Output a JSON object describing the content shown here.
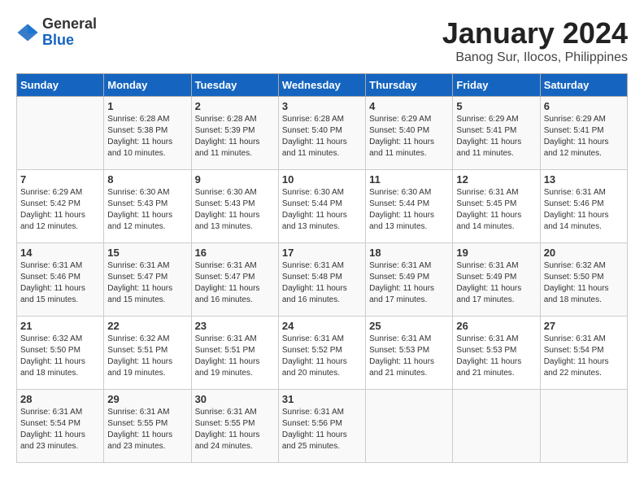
{
  "header": {
    "logo_general": "General",
    "logo_blue": "Blue",
    "month_title": "January 2024",
    "location": "Banog Sur, Ilocos, Philippines"
  },
  "days_of_week": [
    "Sunday",
    "Monday",
    "Tuesday",
    "Wednesday",
    "Thursday",
    "Friday",
    "Saturday"
  ],
  "weeks": [
    [
      {
        "day": "",
        "sunrise": "",
        "sunset": "",
        "daylight": ""
      },
      {
        "day": "1",
        "sunrise": "Sunrise: 6:28 AM",
        "sunset": "Sunset: 5:38 PM",
        "daylight": "Daylight: 11 hours and 10 minutes."
      },
      {
        "day": "2",
        "sunrise": "Sunrise: 6:28 AM",
        "sunset": "Sunset: 5:39 PM",
        "daylight": "Daylight: 11 hours and 11 minutes."
      },
      {
        "day": "3",
        "sunrise": "Sunrise: 6:28 AM",
        "sunset": "Sunset: 5:40 PM",
        "daylight": "Daylight: 11 hours and 11 minutes."
      },
      {
        "day": "4",
        "sunrise": "Sunrise: 6:29 AM",
        "sunset": "Sunset: 5:40 PM",
        "daylight": "Daylight: 11 hours and 11 minutes."
      },
      {
        "day": "5",
        "sunrise": "Sunrise: 6:29 AM",
        "sunset": "Sunset: 5:41 PM",
        "daylight": "Daylight: 11 hours and 11 minutes."
      },
      {
        "day": "6",
        "sunrise": "Sunrise: 6:29 AM",
        "sunset": "Sunset: 5:41 PM",
        "daylight": "Daylight: 11 hours and 12 minutes."
      }
    ],
    [
      {
        "day": "7",
        "sunrise": "Sunrise: 6:29 AM",
        "sunset": "Sunset: 5:42 PM",
        "daylight": "Daylight: 11 hours and 12 minutes."
      },
      {
        "day": "8",
        "sunrise": "Sunrise: 6:30 AM",
        "sunset": "Sunset: 5:43 PM",
        "daylight": "Daylight: 11 hours and 12 minutes."
      },
      {
        "day": "9",
        "sunrise": "Sunrise: 6:30 AM",
        "sunset": "Sunset: 5:43 PM",
        "daylight": "Daylight: 11 hours and 13 minutes."
      },
      {
        "day": "10",
        "sunrise": "Sunrise: 6:30 AM",
        "sunset": "Sunset: 5:44 PM",
        "daylight": "Daylight: 11 hours and 13 minutes."
      },
      {
        "day": "11",
        "sunrise": "Sunrise: 6:30 AM",
        "sunset": "Sunset: 5:44 PM",
        "daylight": "Daylight: 11 hours and 13 minutes."
      },
      {
        "day": "12",
        "sunrise": "Sunrise: 6:31 AM",
        "sunset": "Sunset: 5:45 PM",
        "daylight": "Daylight: 11 hours and 14 minutes."
      },
      {
        "day": "13",
        "sunrise": "Sunrise: 6:31 AM",
        "sunset": "Sunset: 5:46 PM",
        "daylight": "Daylight: 11 hours and 14 minutes."
      }
    ],
    [
      {
        "day": "14",
        "sunrise": "Sunrise: 6:31 AM",
        "sunset": "Sunset: 5:46 PM",
        "daylight": "Daylight: 11 hours and 15 minutes."
      },
      {
        "day": "15",
        "sunrise": "Sunrise: 6:31 AM",
        "sunset": "Sunset: 5:47 PM",
        "daylight": "Daylight: 11 hours and 15 minutes."
      },
      {
        "day": "16",
        "sunrise": "Sunrise: 6:31 AM",
        "sunset": "Sunset: 5:47 PM",
        "daylight": "Daylight: 11 hours and 16 minutes."
      },
      {
        "day": "17",
        "sunrise": "Sunrise: 6:31 AM",
        "sunset": "Sunset: 5:48 PM",
        "daylight": "Daylight: 11 hours and 16 minutes."
      },
      {
        "day": "18",
        "sunrise": "Sunrise: 6:31 AM",
        "sunset": "Sunset: 5:49 PM",
        "daylight": "Daylight: 11 hours and 17 minutes."
      },
      {
        "day": "19",
        "sunrise": "Sunrise: 6:31 AM",
        "sunset": "Sunset: 5:49 PM",
        "daylight": "Daylight: 11 hours and 17 minutes."
      },
      {
        "day": "20",
        "sunrise": "Sunrise: 6:32 AM",
        "sunset": "Sunset: 5:50 PM",
        "daylight": "Daylight: 11 hours and 18 minutes."
      }
    ],
    [
      {
        "day": "21",
        "sunrise": "Sunrise: 6:32 AM",
        "sunset": "Sunset: 5:50 PM",
        "daylight": "Daylight: 11 hours and 18 minutes."
      },
      {
        "day": "22",
        "sunrise": "Sunrise: 6:32 AM",
        "sunset": "Sunset: 5:51 PM",
        "daylight": "Daylight: 11 hours and 19 minutes."
      },
      {
        "day": "23",
        "sunrise": "Sunrise: 6:31 AM",
        "sunset": "Sunset: 5:51 PM",
        "daylight": "Daylight: 11 hours and 19 minutes."
      },
      {
        "day": "24",
        "sunrise": "Sunrise: 6:31 AM",
        "sunset": "Sunset: 5:52 PM",
        "daylight": "Daylight: 11 hours and 20 minutes."
      },
      {
        "day": "25",
        "sunrise": "Sunrise: 6:31 AM",
        "sunset": "Sunset: 5:53 PM",
        "daylight": "Daylight: 11 hours and 21 minutes."
      },
      {
        "day": "26",
        "sunrise": "Sunrise: 6:31 AM",
        "sunset": "Sunset: 5:53 PM",
        "daylight": "Daylight: 11 hours and 21 minutes."
      },
      {
        "day": "27",
        "sunrise": "Sunrise: 6:31 AM",
        "sunset": "Sunset: 5:54 PM",
        "daylight": "Daylight: 11 hours and 22 minutes."
      }
    ],
    [
      {
        "day": "28",
        "sunrise": "Sunrise: 6:31 AM",
        "sunset": "Sunset: 5:54 PM",
        "daylight": "Daylight: 11 hours and 23 minutes."
      },
      {
        "day": "29",
        "sunrise": "Sunrise: 6:31 AM",
        "sunset": "Sunset: 5:55 PM",
        "daylight": "Daylight: 11 hours and 23 minutes."
      },
      {
        "day": "30",
        "sunrise": "Sunrise: 6:31 AM",
        "sunset": "Sunset: 5:55 PM",
        "daylight": "Daylight: 11 hours and 24 minutes."
      },
      {
        "day": "31",
        "sunrise": "Sunrise: 6:31 AM",
        "sunset": "Sunset: 5:56 PM",
        "daylight": "Daylight: 11 hours and 25 minutes."
      },
      {
        "day": "",
        "sunrise": "",
        "sunset": "",
        "daylight": ""
      },
      {
        "day": "",
        "sunrise": "",
        "sunset": "",
        "daylight": ""
      },
      {
        "day": "",
        "sunrise": "",
        "sunset": "",
        "daylight": ""
      }
    ]
  ]
}
